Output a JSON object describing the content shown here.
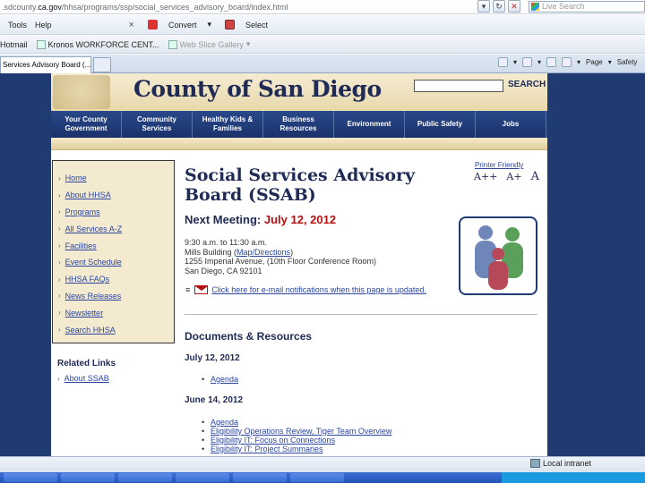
{
  "browser": {
    "url_prefix": ".sdcounty.",
    "url_domain": "ca.gov",
    "url_path": "/hhsa/programs/ssp/social_services_advisory_board/index.html",
    "live_search_placeholder": "Live Search",
    "menu": {
      "tools": "Tools",
      "help": "Help",
      "convert": "Convert",
      "select": "Select"
    },
    "favorites": {
      "hotmail": "Hotmail",
      "kronos": "Kronos WORKFORCE CENT...",
      "web_slice": "Web Slice Gallery"
    },
    "tab_title": "Services Advisory Board (...",
    "page_menu": "Page",
    "safety_menu": "Safety",
    "status_zone": "Local intranet"
  },
  "site": {
    "title": "County of San Diego",
    "search_label": "SEARCH",
    "nav": [
      "Your County Government",
      "Community Services",
      "Healthy Kids & Families",
      "Business Resources",
      "Environment",
      "Public Safety",
      "Jobs"
    ]
  },
  "leftnav": {
    "items": [
      "Home",
      "About HHSA",
      "Programs",
      "All Services A-Z",
      "Facilities",
      "Event Schedule",
      "HHSA FAQs",
      "News Releases",
      "Newsletter",
      "Search HHSA"
    ],
    "related_heading": "Related Links",
    "related_item": "About SSAB"
  },
  "main": {
    "title": "Social Services Advisory Board (SSAB)",
    "printer_friendly": "Printer Friendly",
    "font_sizes": [
      "A++",
      "A+",
      "A"
    ],
    "next_meeting_label": "Next Meeting:",
    "next_meeting_date": "July 12, 2012",
    "time": "9:30 a.m. to 11:30 a.m.",
    "building_prefix": "Mills Building (",
    "map_link": "Map/Directions",
    "building_suffix": ")",
    "address1": "1255 Imperial Avenue, (10th Floor Conference Room)",
    "address2": "San Diego, CA 92101",
    "email_link": "Click here for e-mail notifications when this page is updated.",
    "docs_heading": "Documents & Resources",
    "sections": [
      {
        "date": "July 12, 2012",
        "links": [
          "Agenda"
        ]
      },
      {
        "date": "June 14, 2012",
        "links": [
          "Agenda",
          "Eligibility Operations Review, Tiger Team Overview",
          "Eligibility IT: Focus on Connections",
          "Eligibility IT: Project Summaries"
        ]
      }
    ]
  },
  "colors": {
    "navy": "#1f3b72",
    "title": "#1f2a55",
    "date_red": "#b31212",
    "link": "#2a46a0",
    "tan": "#f3ead0"
  }
}
